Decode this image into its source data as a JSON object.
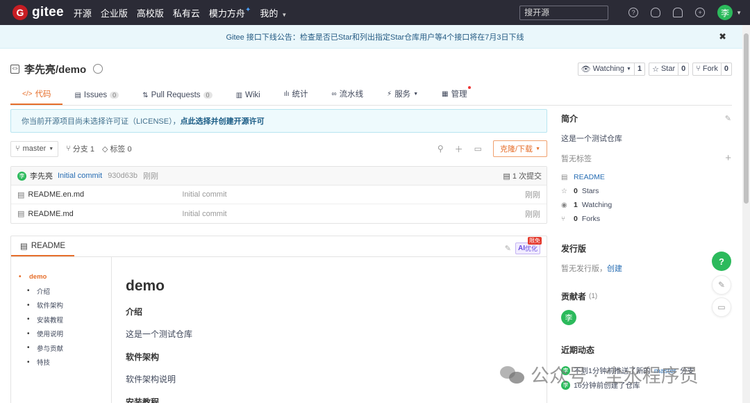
{
  "topnav": {
    "logo_mark": "G",
    "logo_text": "gitee",
    "items": [
      "开源",
      "企业版",
      "高校版",
      "私有云",
      "模力方舟",
      "我的"
    ],
    "search_placeholder": "搜开源",
    "avatar": "李"
  },
  "announcement": {
    "text": "Gitee 接口下线公告：检查是否已Star和列出指定Star仓库用户等4个接口将在7月3日下线",
    "close": "✖"
  },
  "repo": {
    "name": "李先亮/demo",
    "watching": "Watching",
    "watching_count": "1",
    "star": "Star",
    "star_count": "0",
    "fork": "Fork",
    "fork_count": "0"
  },
  "tabs": [
    {
      "icon": "</>",
      "label": "代码"
    },
    {
      "icon": "▤",
      "label": "Issues",
      "badge": "0"
    },
    {
      "icon": "⇅",
      "label": "Pull Requests",
      "badge": "0"
    },
    {
      "icon": "▥",
      "label": "Wiki"
    },
    {
      "icon": "ılı",
      "label": "统计"
    },
    {
      "icon": "∞",
      "label": "流水线"
    },
    {
      "icon": "⚡",
      "label": "服务"
    },
    {
      "icon": "▦",
      "label": "管理"
    }
  ],
  "license": {
    "text": "你当前开源项目尚未选择许可证（LICENSE），",
    "link": "点此选择并创建开源许可"
  },
  "branch": {
    "name": "master",
    "branches": "分支 1",
    "tags": "标签 0",
    "clone": "克隆/下载"
  },
  "commit": {
    "avatar": "李",
    "author": "李先亮",
    "message": "Initial commit",
    "hash": "930d63b",
    "time": "刚刚",
    "count": "1 次提交"
  },
  "files": [
    {
      "name": "README.en.md",
      "message": "Initial commit",
      "time": "刚刚"
    },
    {
      "name": "README.md",
      "message": "Initial commit",
      "time": "刚刚"
    }
  ],
  "readme": {
    "tab": "README",
    "ai": "AI",
    "ai_sub": "优化",
    "ai_badge": "限免",
    "toc": [
      "demo",
      "介绍",
      "软件架构",
      "安装教程",
      "使用说明",
      "参与贡献",
      "特技"
    ],
    "h1": "demo",
    "intro_h": "介绍",
    "intro_p": "这是一个测试仓库",
    "arch_h": "软件架构",
    "arch_p": "软件架构说明",
    "install_h": "安装教程"
  },
  "sidebar": {
    "intro_title": "简介",
    "intro_desc": "这是一个测试仓库",
    "no_tags": "暂无标签",
    "readme": "README",
    "stars": "0",
    "stars_label": "Stars",
    "watching": "1",
    "watching_label": "Watching",
    "forks": "0",
    "forks_label": "Forks",
    "release_title": "发行版",
    "no_release": "暂无发行版，",
    "create": "创建",
    "contrib_title": "贡献者",
    "contrib_count": "(1)",
    "contrib_avatar": "李",
    "activity_title": "近期动态",
    "act1_prefix": "不到1分钟前推送了新的",
    "act1_branch": "master",
    "act1_suffix": "分支",
    "act2": "16分钟前创建了仓库"
  },
  "float": {
    "help": "?"
  },
  "watermark": "公众号 · 尘水程序员"
}
